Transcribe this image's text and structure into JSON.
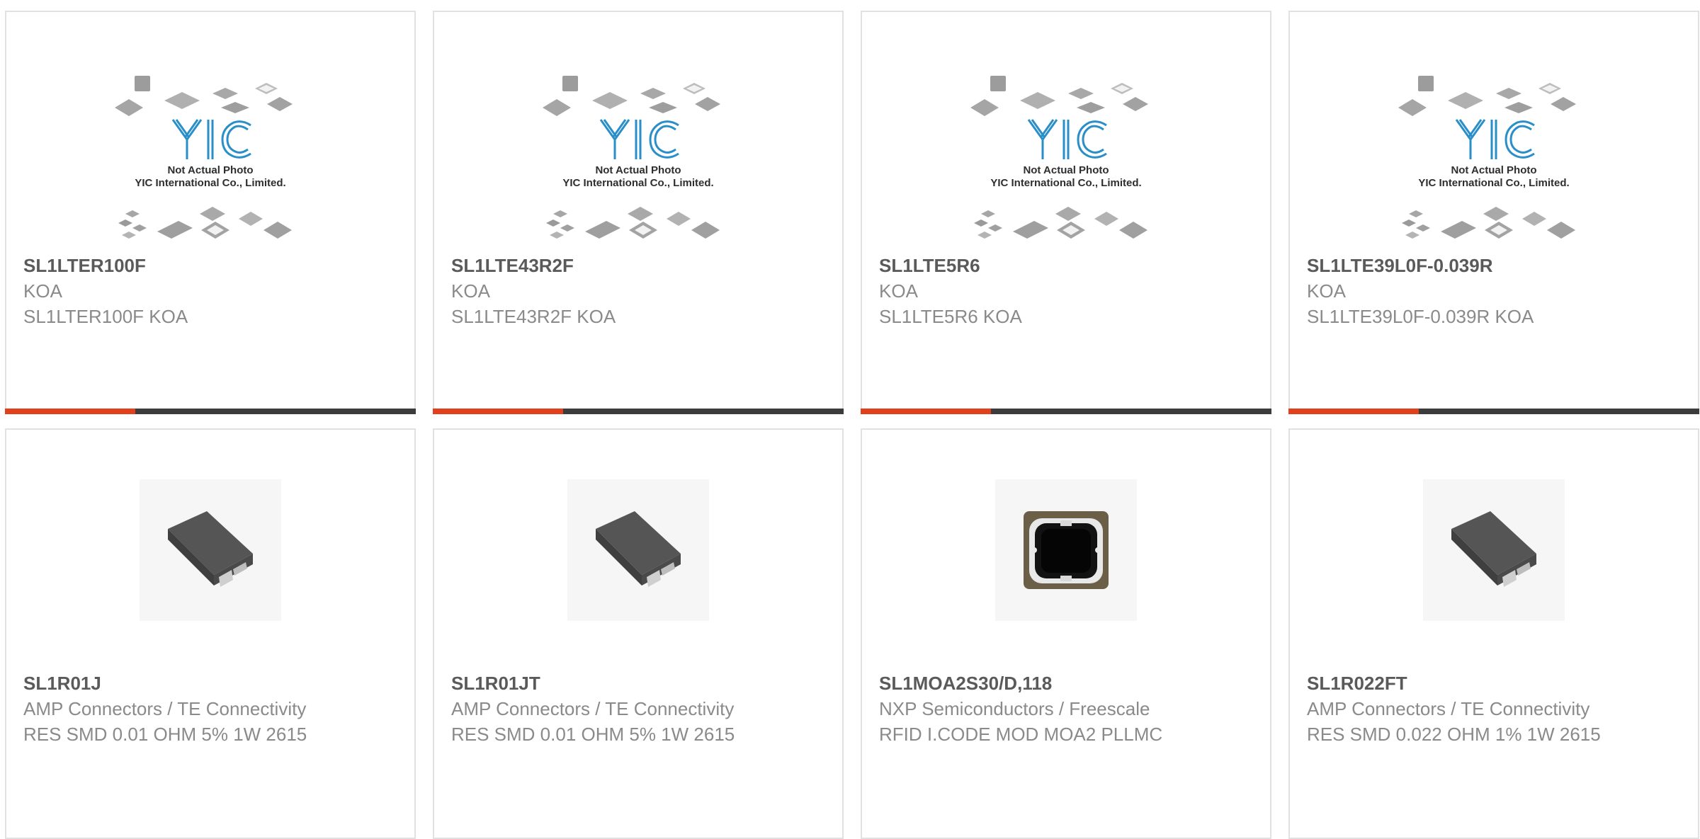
{
  "placeholder": {
    "line1": "Not Actual Photo",
    "line2": "YIC International Co., Limited.",
    "logo": "YIC"
  },
  "colors": {
    "accent": "#e2401c",
    "bar": "#3c3c3c",
    "border": "#e1e1e1",
    "title": "#5a5a5a",
    "muted": "#8a8a8a"
  },
  "products": [
    {
      "part_number": "SL1LTER100F",
      "manufacturer": "KOA",
      "description": "SL1LTER100F KOA",
      "image": "not-actual-photo-placeholder"
    },
    {
      "part_number": "SL1LTE43R2F",
      "manufacturer": "KOA",
      "description": "SL1LTE43R2F KOA",
      "image": "not-actual-photo-placeholder"
    },
    {
      "part_number": "SL1LTE5R6",
      "manufacturer": "KOA",
      "description": "SL1LTE5R6 KOA",
      "image": "not-actual-photo-placeholder"
    },
    {
      "part_number": "SL1LTE39L0F-0.039R",
      "manufacturer": "KOA",
      "description": "SL1LTE39L0F-0.039R KOA",
      "image": "not-actual-photo-placeholder"
    },
    {
      "part_number": "SL1R01J",
      "manufacturer": "AMP Connectors / TE Connectivity",
      "description": "RES SMD 0.01 OHM 5% 1W 2615",
      "image": "smd-resistor-photo"
    },
    {
      "part_number": "SL1R01JT",
      "manufacturer": "AMP Connectors / TE Connectivity",
      "description": "RES SMD 0.01 OHM 5% 1W 2615",
      "image": "smd-resistor-photo"
    },
    {
      "part_number": "SL1MOA2S30/D,118",
      "manufacturer": "NXP Semiconductors / Freescale",
      "description": "RFID I.CODE MOD MOA2 PLLMC",
      "image": "rfid-module-photo"
    },
    {
      "part_number": "SL1R022FT",
      "manufacturer": "AMP Connectors / TE Connectivity",
      "description": "RES SMD 0.022 OHM 1% 1W 2615",
      "image": "smd-resistor-photo"
    }
  ]
}
